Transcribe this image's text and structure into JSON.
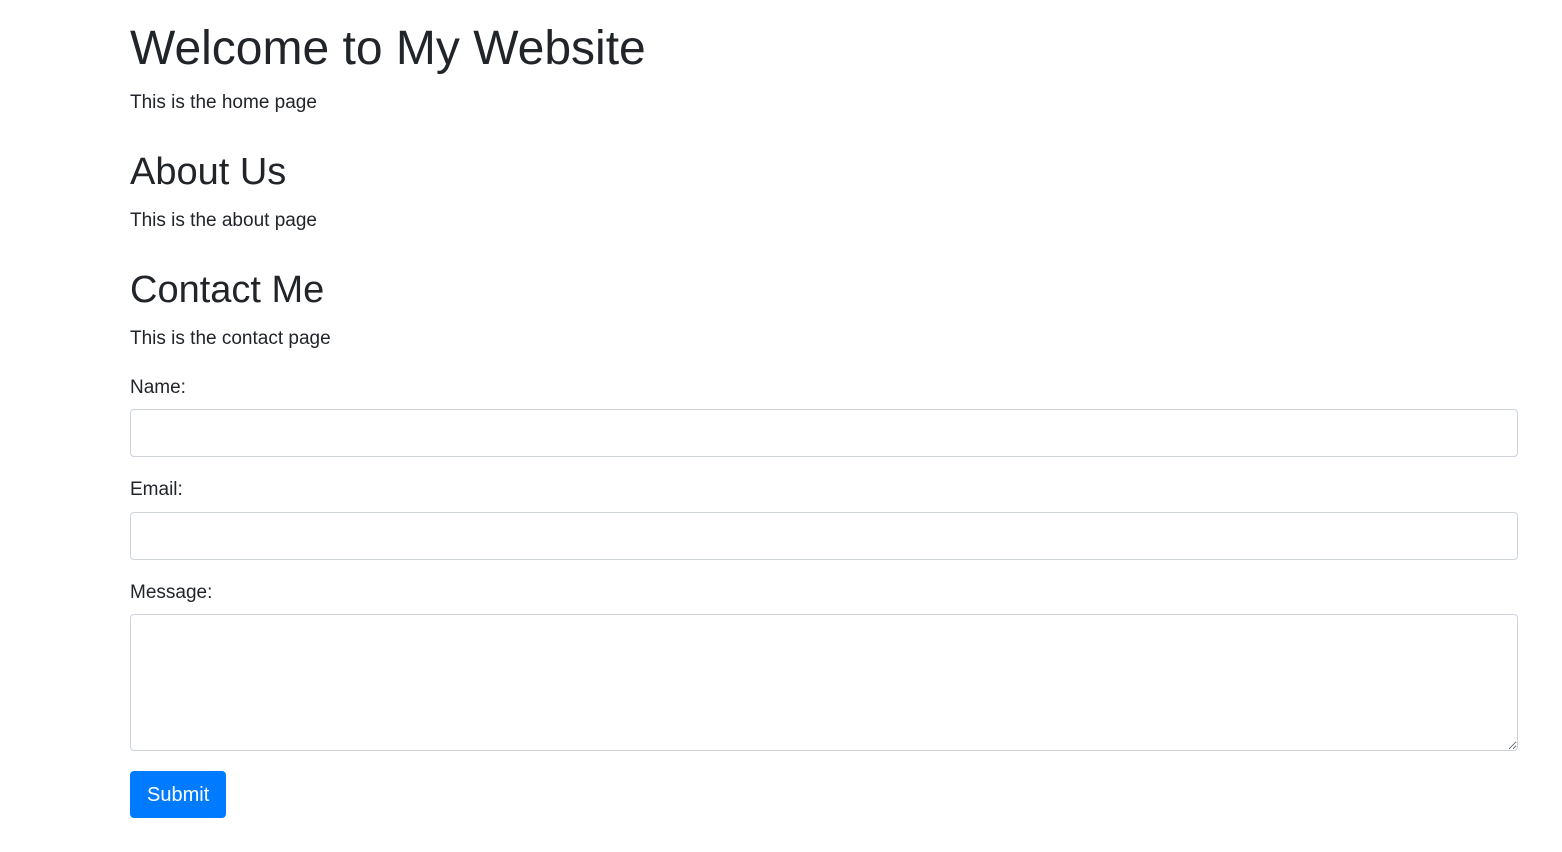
{
  "home": {
    "title": "Welcome to My Website",
    "text": "This is the home page"
  },
  "about": {
    "title": "About Us",
    "text": "This is the about page"
  },
  "contact": {
    "title": "Contact Me",
    "text": "This is the contact page",
    "form": {
      "name_label": "Name:",
      "name_value": "",
      "email_label": "Email:",
      "email_value": "",
      "message_label": "Message:",
      "message_value": "",
      "submit_label": "Submit"
    }
  },
  "colors": {
    "text": "#212529",
    "button": "#007bff",
    "input_border": "#ced4da"
  }
}
